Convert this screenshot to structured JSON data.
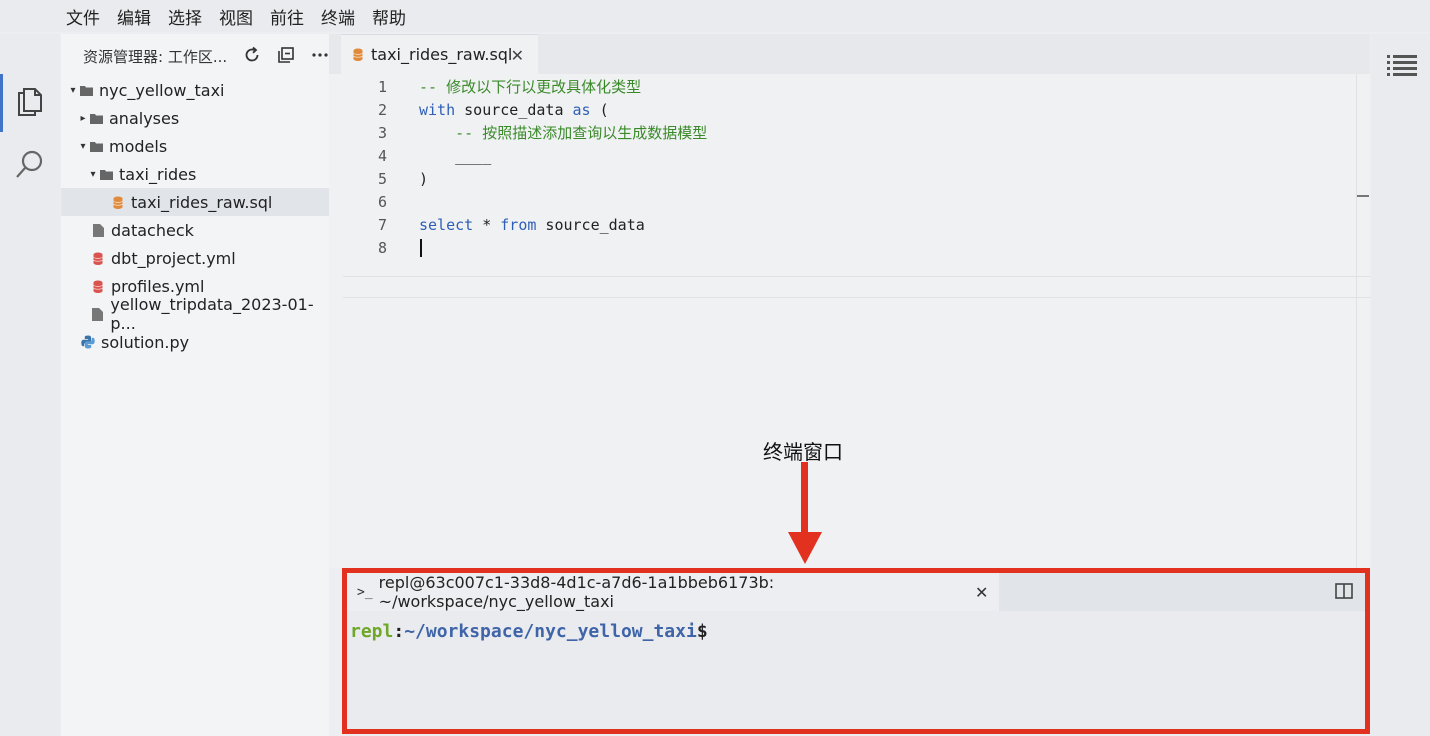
{
  "menubar": {
    "items": [
      "文件",
      "编辑",
      "选择",
      "视图",
      "前往",
      "终端",
      "帮助"
    ]
  },
  "activity_bar": {
    "icons": [
      "explorer-files-icon",
      "search-icon"
    ]
  },
  "sidebar": {
    "title": "资源管理器: 工作区...",
    "actions": [
      "refresh-icon",
      "collapse-all-icon",
      "more-icon"
    ],
    "tree": [
      {
        "label": "nyc_yellow_taxi",
        "type": "folder",
        "expanded": true
      },
      {
        "label": "analyses",
        "type": "folder",
        "expanded": false
      },
      {
        "label": "models",
        "type": "folder",
        "expanded": true
      },
      {
        "label": "taxi_rides",
        "type": "folder",
        "expanded": true
      },
      {
        "label": "taxi_rides_raw.sql",
        "type": "sql-file",
        "selected": true
      },
      {
        "label": "datacheck",
        "type": "file"
      },
      {
        "label": "dbt_project.yml",
        "type": "yml-file"
      },
      {
        "label": "profiles.yml",
        "type": "yml-file"
      },
      {
        "label": "yellow_tripdata_2023-01-p...",
        "type": "file"
      },
      {
        "label": "solution.py",
        "type": "python-file"
      }
    ]
  },
  "editor": {
    "tab": {
      "label": "taxi_rides_raw.sql"
    },
    "lines": [
      {
        "num": "1",
        "text": "-- 修改以下行以更改具体化类型"
      },
      {
        "num": "2",
        "text": "with source_data as ("
      },
      {
        "num": "3",
        "text": "    -- 按照描述添加查询以生成数据模型"
      },
      {
        "num": "4",
        "text": "    ____"
      },
      {
        "num": "5",
        "text": ")"
      },
      {
        "num": "6",
        "text": ""
      },
      {
        "num": "7",
        "text": "select * from source_data"
      },
      {
        "num": "8",
        "text": ""
      }
    ]
  },
  "annotation": {
    "label": "终端窗口",
    "color": "#e2321f"
  },
  "terminal": {
    "tab_label": "repl@63c007c1-33d8-4d1c-a7d6-1a1bbeb6173b: ~/workspace/nyc_yellow_taxi",
    "prompt_user": "repl",
    "prompt_colon": ":",
    "prompt_path": "~/workspace/nyc_yellow_taxi",
    "prompt_dollar": "$"
  },
  "colors": {
    "accent": "#3f74c9",
    "comment": "#3a8a2a",
    "keyword": "#2f5fb5",
    "prompt_user": "#6fa828",
    "prompt_path": "#3f64a8"
  }
}
